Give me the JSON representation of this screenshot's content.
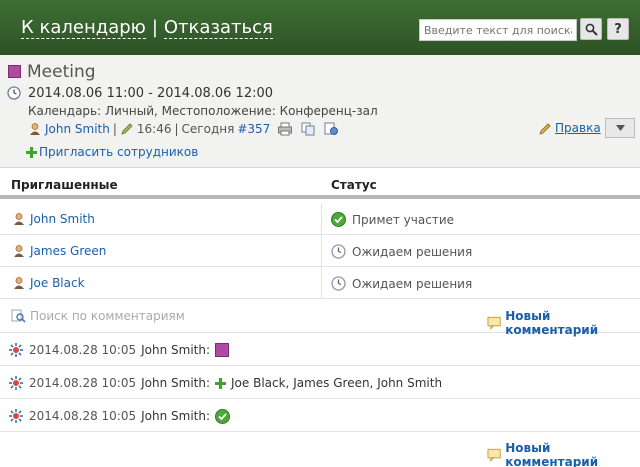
{
  "nav": {
    "back_label": "К календарю",
    "separator": "|",
    "decline_label": "Отказаться"
  },
  "search": {
    "placeholder": "Введите текст для поиска",
    "help_label": "?"
  },
  "event": {
    "color": "#b049a3",
    "title": "Meeting",
    "time": "2014.08.06 11:00 - 2014.08.06 12:00",
    "meta": "Календарь: Личный, Местоположение: Конференц-зал",
    "organizer": "John Smith",
    "created_time": "16:46",
    "created_day": "Сегодня",
    "id_link": "#357",
    "invite_label": "Пригласить сотрудников",
    "edit_label": "Правка"
  },
  "table": {
    "headers": {
      "invited": "Приглашенные",
      "status": "Статус"
    },
    "rows": [
      {
        "name": "John Smith",
        "status": "Примет участие",
        "status_icon": "check-icon"
      },
      {
        "name": "James Green",
        "status": "Ожидаем решения",
        "status_icon": "clock-icon"
      },
      {
        "name": "Joe Black",
        "status": "Ожидаем решения",
        "status_icon": "clock-icon"
      }
    ]
  },
  "comments": {
    "search_placeholder": "Поиск по комментариям",
    "new_label": "Новый комментарий",
    "items": [
      {
        "date": "2014.08.28 10:05",
        "author": "John Smith:",
        "text": ""
      },
      {
        "date": "2014.08.28 10:05",
        "author": "John Smith:",
        "text": "Joe Black, James Green, John Smith"
      },
      {
        "date": "2014.08.28 10:05",
        "author": "John Smith:",
        "text": ""
      }
    ]
  }
}
